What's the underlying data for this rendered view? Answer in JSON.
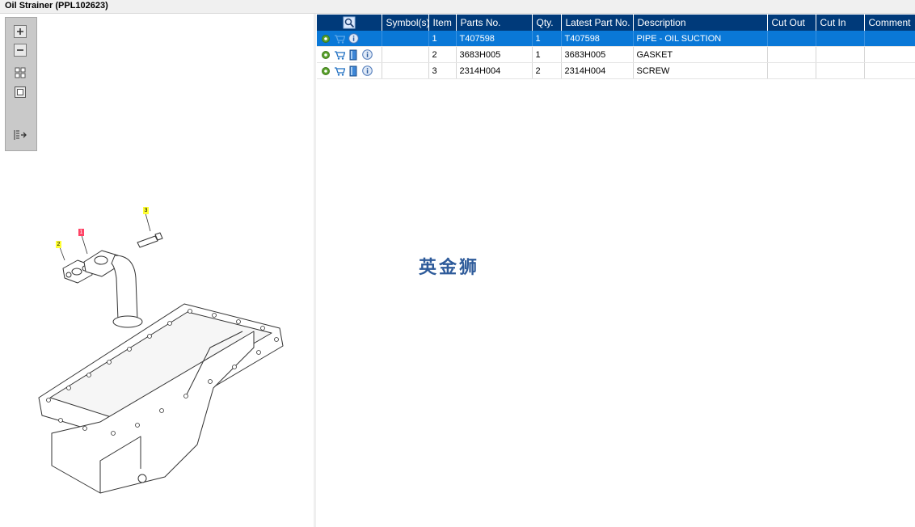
{
  "window": {
    "title": "Oil Strainer (PPL102623)"
  },
  "toolbar": {
    "buttons": [
      {
        "name": "zoom-in-icon"
      },
      {
        "name": "zoom-out-icon"
      },
      {
        "name": "fit-all-icon"
      },
      {
        "name": "actual-size-icon"
      },
      {
        "name": "sidebar-toggle-icon"
      }
    ]
  },
  "drawing": {
    "callouts": [
      {
        "label": "3",
        "color": "yellow"
      },
      {
        "label": "2",
        "color": "yellow"
      },
      {
        "label": "1",
        "color": "red"
      }
    ]
  },
  "grid": {
    "columns": [
      "",
      "Symbol(s)",
      "Item",
      "Parts No.",
      "Qty.",
      "Latest Part No.",
      "Description",
      "Cut Out",
      "Cut In",
      "Comment"
    ],
    "rows": [
      {
        "item": "1",
        "part_no": "T407598",
        "qty": "1",
        "latest_part_no": "T407598",
        "description": "PIPE - OIL SUCTION",
        "symbols": "",
        "cut_out": "",
        "cut_in": "",
        "comment": "",
        "selected": true
      },
      {
        "item": "2",
        "part_no": "3683H005",
        "qty": "1",
        "latest_part_no": "3683H005",
        "description": "GASKET",
        "symbols": "",
        "cut_out": "",
        "cut_in": "",
        "comment": "",
        "selected": false
      },
      {
        "item": "3",
        "part_no": "2314H004",
        "qty": "2",
        "latest_part_no": "2314H004",
        "description": "SCREW",
        "symbols": "",
        "cut_out": "",
        "cut_in": "",
        "comment": "",
        "selected": false
      }
    ]
  },
  "watermark": {
    "text": "英金狮"
  },
  "colors": {
    "header_bg": "#003a7a",
    "selected_row": "#0a78d7",
    "callout_yellow": "#ffff33",
    "callout_red": "#ff4466"
  }
}
